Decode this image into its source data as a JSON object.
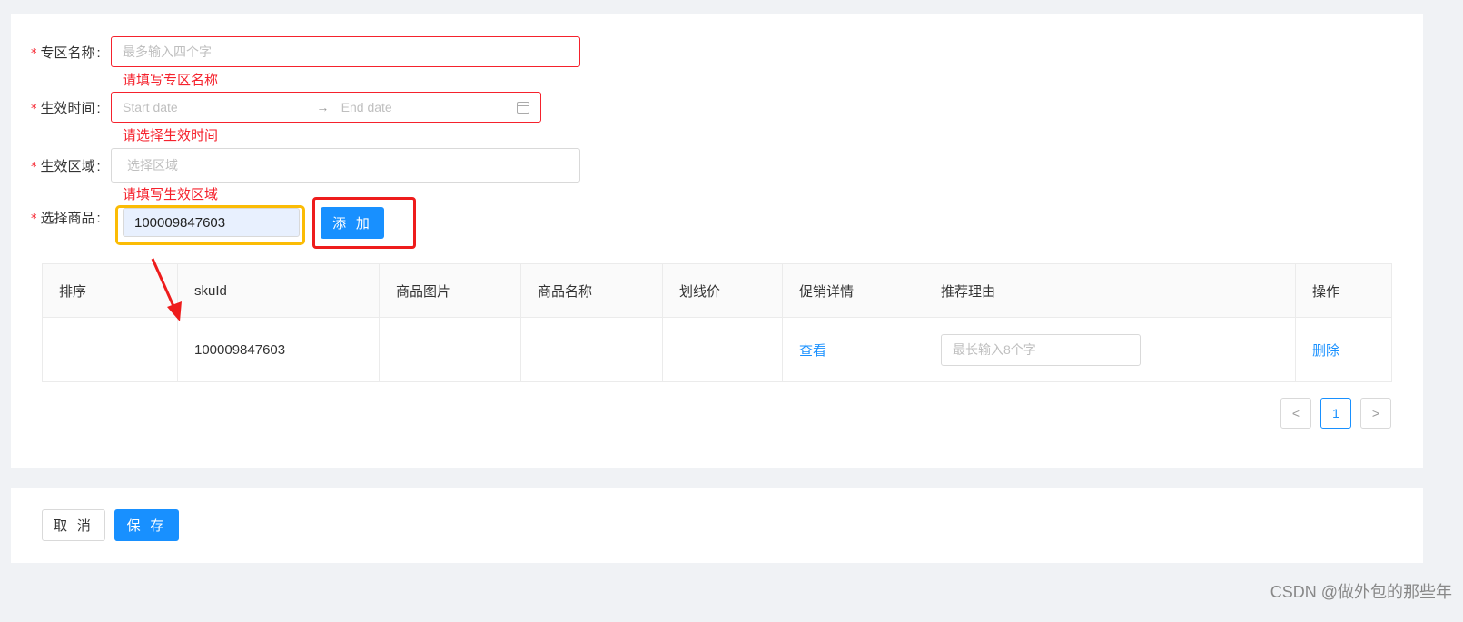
{
  "form": {
    "zone_name": {
      "label": "专区名称",
      "placeholder": "最多输入四个字",
      "error": "请填写专区名称"
    },
    "effective_time": {
      "label": "生效时间",
      "start_placeholder": "Start date",
      "arrow": "→",
      "end_placeholder": "End date",
      "error": "请选择生效时间"
    },
    "effective_region": {
      "label": "生效区域",
      "placeholder": "选择区域",
      "error": "请填写生效区域"
    },
    "select_product": {
      "label": "选择商品",
      "value": "100009847603",
      "add_button": "添 加"
    },
    "required_mark": "*",
    "colon": ":"
  },
  "table": {
    "headers": [
      "排序",
      "skuId",
      "商品图片",
      "商品名称",
      "划线价",
      "促销详情",
      "推荐理由",
      "操作"
    ],
    "rows": [
      {
        "order": "",
        "sku_id": "100009847603",
        "image": "",
        "name": "",
        "price": "",
        "promo_link": "查看",
        "reason_placeholder": "最长输入8个字",
        "action": "删除"
      }
    ]
  },
  "pagination": {
    "prev": "<",
    "current": "1",
    "next": ">"
  },
  "footer": {
    "cancel": "取 消",
    "save": "保 存"
  },
  "watermark": "CSDN @做外包的那些年",
  "colors": {
    "primary": "#1890ff",
    "error": "#f5222d",
    "highlight_yellow": "#fbbc05",
    "highlight_red": "#ee1c1c"
  }
}
